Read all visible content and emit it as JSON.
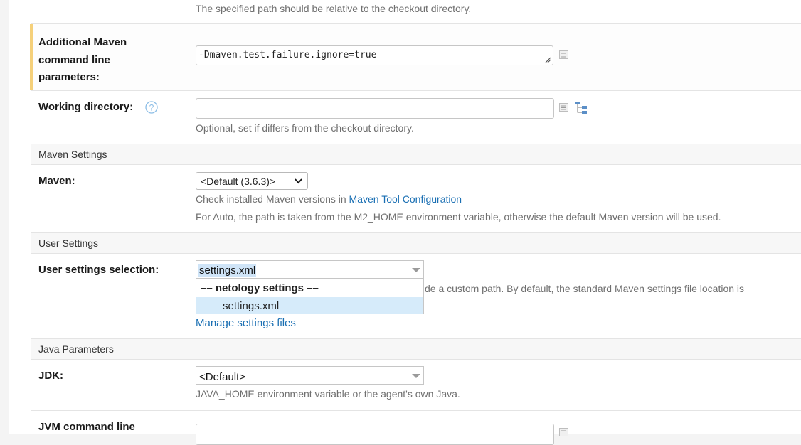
{
  "top_hint": "The specified path should be relative to the checkout directory.",
  "maven_params": {
    "label_line1": "Additional Maven",
    "label_line2": "command line",
    "label_line3": "parameters:",
    "value": "-Dmaven.test.failure.ignore=true"
  },
  "working_dir": {
    "label": "Working directory:",
    "value": "",
    "hint": "Optional, set if differs from the checkout directory."
  },
  "maven_settings": {
    "section_title": "Maven Settings",
    "label": "Maven:",
    "selected": "<Default (3.6.3)>",
    "hint_prefix": "Check installed Maven versions in ",
    "hint_link": "Maven Tool Configuration",
    "hint2": "For Auto, the path is taken from the M2_HOME environment variable, otherwise the default Maven version will be used."
  },
  "user_settings": {
    "section_title": "User Settings",
    "label": "User settings selection:",
    "value": "settings.xml",
    "dropdown_group": "–– netology settings ––",
    "dropdown_option": "settings.xml",
    "hint_partial": "de a custom path. By default, the standard Maven settings file location is",
    "manage_link": "Manage settings files"
  },
  "java_params": {
    "section_title": "Java Parameters",
    "jdk_label": "JDK:",
    "jdk_value": "<Default>",
    "jdk_hint": "JAVA_HOME environment variable or the agent's own Java.",
    "jvm_label": "JVM command line"
  },
  "colors": {
    "accent_bar": "#f5d07a",
    "link": "#1a6fb3",
    "highlight": "#d6ebfa"
  },
  "icons": [
    "list-icon",
    "help-icon",
    "tree-icon",
    "resize-grip-icon",
    "dropdown-arrow-icon"
  ]
}
